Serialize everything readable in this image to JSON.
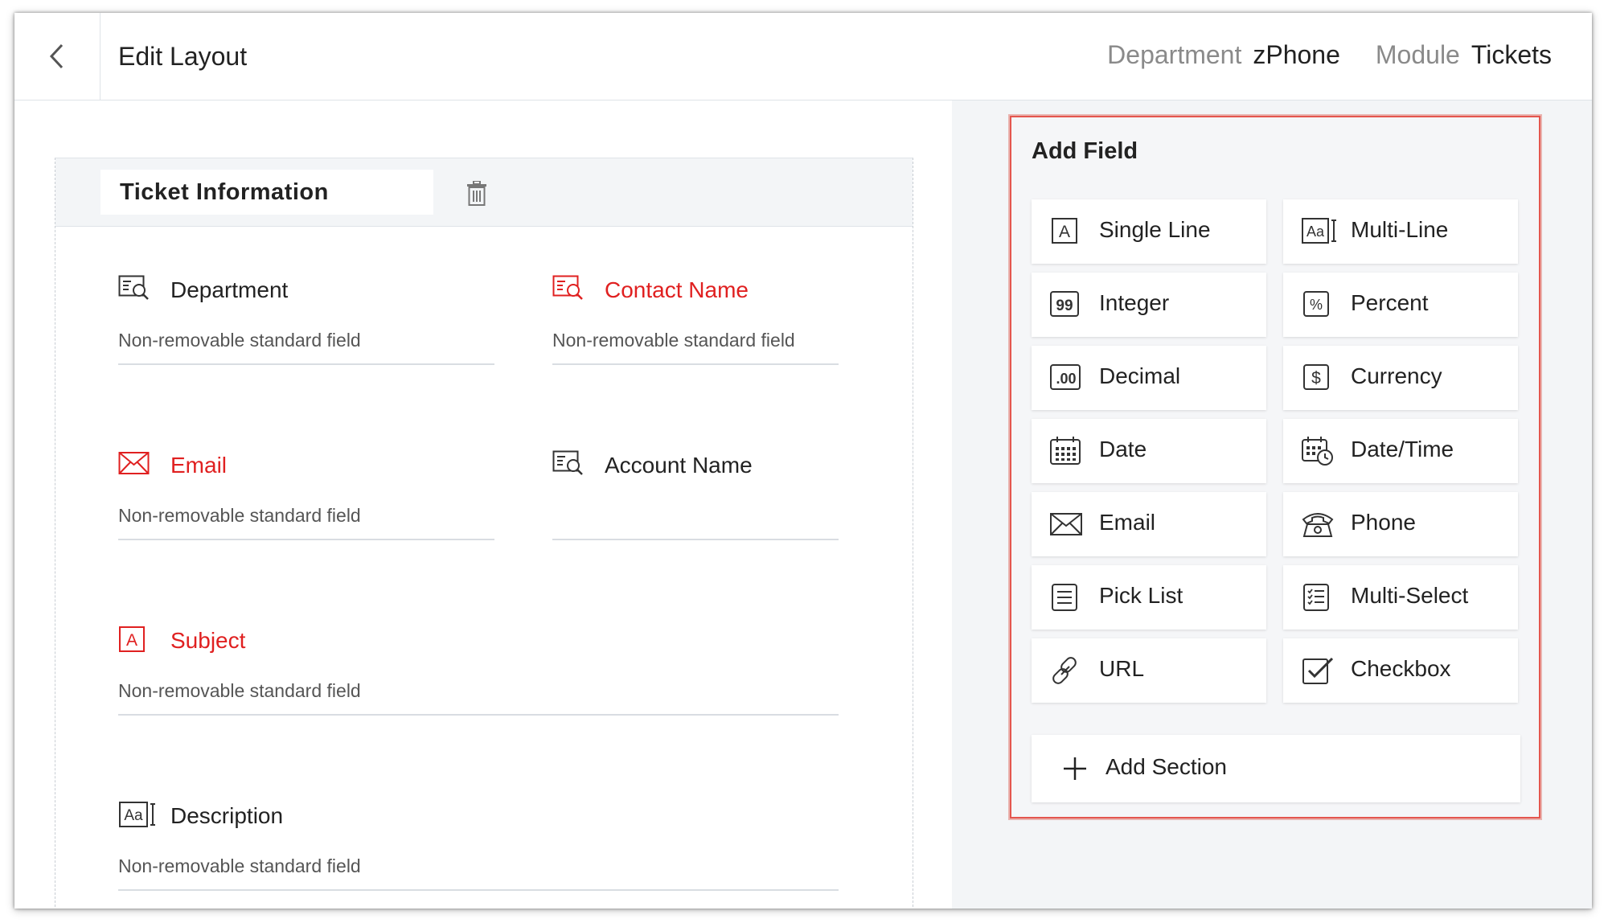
{
  "header": {
    "title": "Edit Layout",
    "department_label": "Department",
    "department_value": "zPhone",
    "module_label": "Module",
    "module_value": "Tickets"
  },
  "section": {
    "name": "Ticket Information"
  },
  "fields": [
    {
      "label": "Department",
      "sub": "Non-removable standard field",
      "required": false,
      "icon": "lookup-icon"
    },
    {
      "label": "Contact Name",
      "sub": "Non-removable standard field",
      "required": true,
      "icon": "lookup-icon"
    },
    {
      "label": "Email",
      "sub": "Non-removable standard field",
      "required": true,
      "icon": "email-icon"
    },
    {
      "label": "Account Name",
      "sub": "",
      "required": false,
      "icon": "lookup-icon"
    },
    {
      "label": "Subject",
      "sub": "Non-removable standard field",
      "required": true,
      "icon": "single-line-icon"
    },
    {
      "label": "Description",
      "sub": "Non-removable standard field",
      "required": false,
      "icon": "multi-line-icon"
    }
  ],
  "panel": {
    "title": "Add Field",
    "tiles": [
      {
        "label": "Single Line",
        "icon": "single-line-icon"
      },
      {
        "label": "Multi-Line",
        "icon": "multi-line-icon"
      },
      {
        "label": "Integer",
        "icon": "integer-icon"
      },
      {
        "label": "Percent",
        "icon": "percent-icon"
      },
      {
        "label": "Decimal",
        "icon": "decimal-icon"
      },
      {
        "label": "Currency",
        "icon": "currency-icon"
      },
      {
        "label": "Date",
        "icon": "calendar-icon"
      },
      {
        "label": "Date/Time",
        "icon": "calendar-clock-icon"
      },
      {
        "label": "Email",
        "icon": "email-icon"
      },
      {
        "label": "Phone",
        "icon": "phone-icon"
      },
      {
        "label": "Pick List",
        "icon": "pick-list-icon"
      },
      {
        "label": "Multi-Select",
        "icon": "multi-select-icon"
      },
      {
        "label": "URL",
        "icon": "link-icon"
      },
      {
        "label": "Checkbox",
        "icon": "checkbox-icon"
      }
    ],
    "add_section_label": "Add Section"
  },
  "colors": {
    "required": "#e02020",
    "panel_border": "#e4564e",
    "panel_bg": "#f5f6f8"
  }
}
